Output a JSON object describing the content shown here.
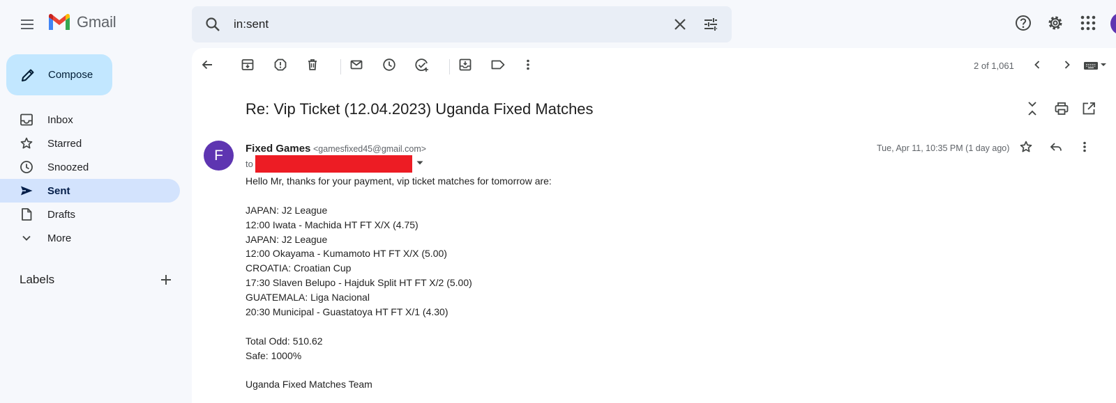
{
  "app": {
    "name": "Gmail"
  },
  "search": {
    "query": "in:sent"
  },
  "compose": {
    "label": "Compose"
  },
  "sidebar": {
    "items": [
      {
        "label": "Inbox",
        "icon": "inbox-icon"
      },
      {
        "label": "Starred",
        "icon": "star-icon"
      },
      {
        "label": "Snoozed",
        "icon": "clock-icon"
      },
      {
        "label": "Sent",
        "icon": "send-icon",
        "active": true
      },
      {
        "label": "Drafts",
        "icon": "draft-icon"
      },
      {
        "label": "More",
        "icon": "chevron-down-icon"
      }
    ],
    "labels_title": "Labels"
  },
  "toolbar": {
    "pager": "2 of 1,061"
  },
  "email": {
    "subject": "Re: Vip Ticket (12.04.2023) Uganda Fixed Matches",
    "sender_name": "Fixed Games",
    "sender_email": "<gamesfixed45@gmail.com>",
    "sender_initial": "F",
    "to_label": "to",
    "date": "Tue, Apr 11, 10:35 PM (1 day ago)",
    "body": [
      "Hello Mr, thanks for your payment, vip ticket matches for tomorrow are:",
      "",
      "JAPAN: J2 League",
      "12:00 Iwata - Machida HT FT X/X (4.75)",
      "JAPAN: J2 League",
      "12:00 Okayama - Kumamoto HT FT X/X (5.00)",
      "CROATIA: Croatian Cup",
      "17:30 Slaven Belupo - Hajduk Split HT FT X/2 (5.00)",
      "GUATEMALA: Liga Nacional",
      "20:30 Municipal - Guastatoya HT FT X/1 (4.30)",
      "",
      "Total Odd: 510.62",
      "Safe: 1000%",
      "",
      "Uganda Fixed Matches Team"
    ]
  },
  "colors": {
    "background": "#f6f8fc",
    "accent": "#c2e7ff",
    "active_nav": "#d3e3fd",
    "avatar": "#5e35b1",
    "redaction": "#ed1c24"
  }
}
